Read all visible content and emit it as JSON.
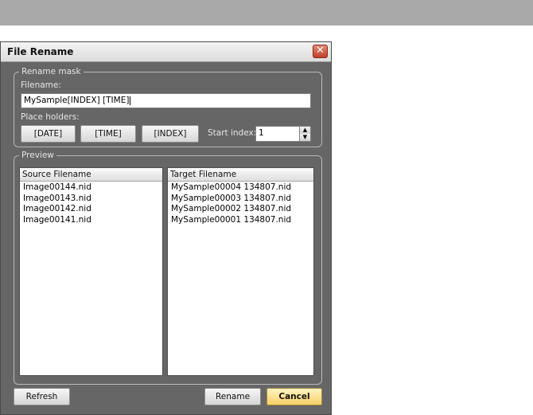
{
  "dialog": {
    "title": "File Rename",
    "close_icon": "close-icon"
  },
  "rename_mask": {
    "group_label": "Rename mask",
    "filename_label": "Filename:",
    "filename_value": "MySample[INDEX] [TIME]",
    "placeholders_label": "Place holders:",
    "date_button": "[DATE]",
    "time_button": "[TIME]",
    "index_button": "[INDEX]",
    "start_index_label": "Start index:",
    "start_index_value": "1"
  },
  "preview": {
    "group_label": "Preview",
    "source_header": "Source Filename",
    "target_header": "Target Filename",
    "source_files": [
      "Image00144.nid",
      "Image00143.nid",
      "Image00142.nid",
      "Image00141.nid"
    ],
    "target_files": [
      "MySample00004 134807.nid",
      "MySample00003 134807.nid",
      "MySample00002 134807.nid",
      "MySample00001 134807.nid"
    ]
  },
  "buttons": {
    "refresh": "Refresh",
    "rename": "Rename",
    "cancel": "Cancel"
  }
}
